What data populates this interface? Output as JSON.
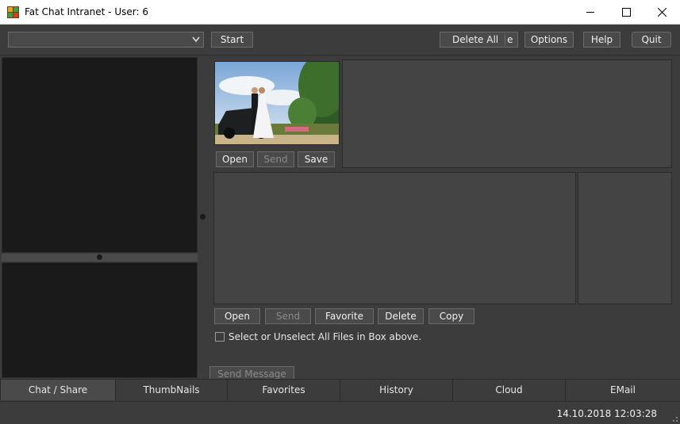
{
  "window": {
    "title": "Fat Chat Intranet - User: 6"
  },
  "toolbar": {
    "combo_value": "",
    "start_label": "Start",
    "delete_all_label": "Delete All",
    "delete_all_overflow": "e",
    "options_label": "Options",
    "help_label": "Help",
    "quit_label": "Quit"
  },
  "image_panel": {
    "open_label": "Open",
    "send_label": "Send",
    "save_label": "Save"
  },
  "files_panel": {
    "open_label": "Open",
    "send_label": "Send",
    "favorite_label": "Favorite",
    "delete_label": "Delete",
    "copy_label": "Copy",
    "select_all_label": "Select or Unselect All Files in Box above."
  },
  "send_message_label": "Send Message",
  "tabs": [
    {
      "label": "Chat / Share"
    },
    {
      "label": "ThumbNails"
    },
    {
      "label": "Favorites"
    },
    {
      "label": "History"
    },
    {
      "label": "Cloud"
    },
    {
      "label": "EMail"
    }
  ],
  "status": {
    "datetime": "14.10.2018 12:03:28"
  },
  "icons": {
    "app": "app-icon",
    "minimize": "minimize-icon",
    "maximize": "maximize-icon",
    "close": "close-icon",
    "dropdown": "chevron-down-icon"
  }
}
